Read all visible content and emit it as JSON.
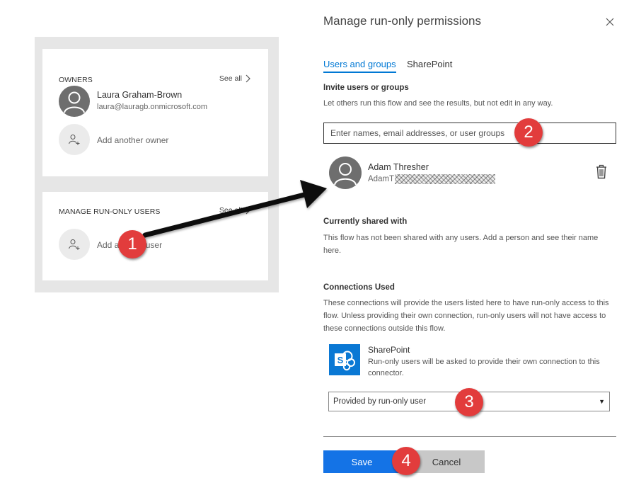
{
  "left_panel": {
    "owners": {
      "title": "OWNERS",
      "see_all": "See all",
      "owner_name": "Laura Graham-Brown",
      "owner_email": "laura@lauragb.onmicrosoft.com",
      "add_owner": "Add another owner"
    },
    "run_only": {
      "title": "MANAGE RUN-ONLY USERS",
      "see_all": "See all",
      "add_user": "Add another user"
    }
  },
  "panel": {
    "title": "Manage run-only permissions",
    "tabs": [
      {
        "label": "Users and groups",
        "active": true
      },
      {
        "label": "SharePoint",
        "active": false
      }
    ],
    "invite": {
      "heading": "Invite users or groups",
      "description": "Let others run this flow and see the results, but not edit in any way.",
      "placeholder": "Enter names, email addresses, or user groups"
    },
    "user": {
      "name": "Adam Thresher",
      "email_prefix": "AdamT"
    },
    "shared": {
      "heading": "Currently shared with",
      "description": "This flow has not been shared with any users. Add a person and see their name here."
    },
    "connections": {
      "heading": "Connections Used",
      "description": "These connections will provide the users listed here to have run-only access to this flow. Unless providing their own connection, run-only users will not have access to these connections outside this flow.",
      "connector_name": "SharePoint",
      "connector_desc": "Run-only users will be asked to provide their own connection to this connector.",
      "selected_option": "Provided by run-only user"
    },
    "buttons": {
      "save": "Save",
      "cancel": "Cancel"
    }
  },
  "annotations": {
    "badges": [
      "1",
      "2",
      "3",
      "4"
    ]
  },
  "colors": {
    "accent": "#0078d4",
    "save_button": "#1473e6",
    "badge": "#e23c3c",
    "sharepoint": "#0a78d4"
  }
}
